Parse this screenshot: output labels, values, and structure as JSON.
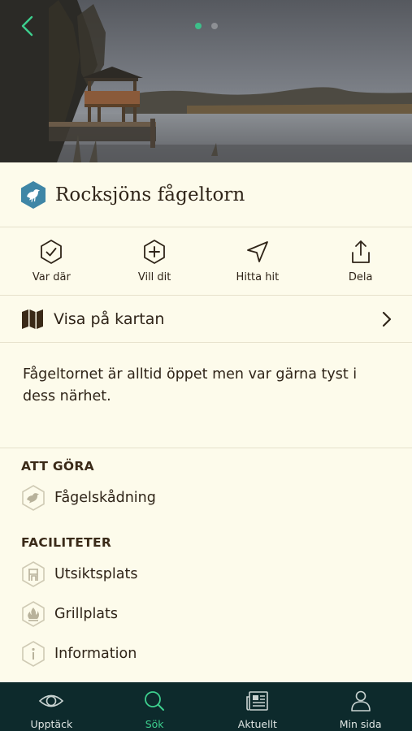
{
  "hero": {
    "slides_total": 2,
    "active_slide": 1
  },
  "place": {
    "title": "Rocksjöns fågeltorn",
    "icon": "bird-badge-icon",
    "badge_color": "#3f86a6"
  },
  "actions": [
    {
      "label": "Var där",
      "icon": "check-hexagon-icon"
    },
    {
      "label": "Vill dit",
      "icon": "plus-hexagon-icon"
    },
    {
      "label": "Hitta hit",
      "icon": "navigation-arrow-icon"
    },
    {
      "label": "Dela",
      "icon": "share-icon"
    }
  ],
  "map_link": {
    "label": "Visa på kartan",
    "icon": "map-icon"
  },
  "description": "Fågeltornet är alltid öppet men var gärna tyst i dess närhet.",
  "todo": {
    "title": "ATT GÖRA",
    "items": [
      {
        "label": "Fågelskådning",
        "icon": "bird-watching-icon"
      }
    ]
  },
  "facilities": {
    "title": "FACILITETER",
    "items": [
      {
        "label": "Utsiktsplats",
        "icon": "viewpoint-icon"
      },
      {
        "label": "Grillplats",
        "icon": "grill-icon"
      },
      {
        "label": "Information",
        "icon": "info-icon"
      }
    ]
  },
  "bottom_nav": [
    {
      "label": "Upptäck",
      "icon": "eye-icon",
      "active": false
    },
    {
      "label": "Sök",
      "icon": "search-icon",
      "active": true
    },
    {
      "label": "Aktuellt",
      "icon": "news-icon",
      "active": false
    },
    {
      "label": "Min sida",
      "icon": "user-icon",
      "active": false
    }
  ],
  "colors": {
    "background": "#fdfbeb",
    "text": "#2f2418",
    "accent": "#3dcf8e",
    "nav_background": "#0d2a2c"
  }
}
